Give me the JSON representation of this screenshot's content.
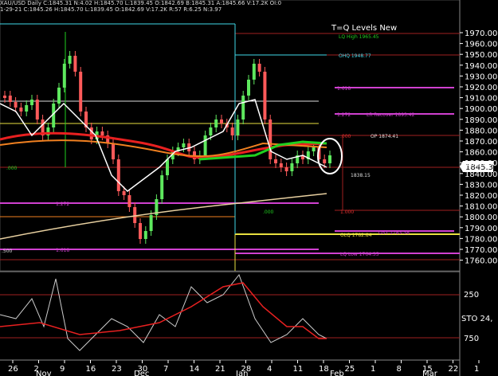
{
  "header": {
    "line1": "XAU/USD Daily  C:1845.31  N:4.02  H:1845.70  L:1839.45  O:1842.69  B:1845.31  A:1845.66  V:17.2K  OI:0",
    "line2": "1-29-21  C:1845.26  H:1845.70  L:1839.45  O:1842.69  V:17.2K  R:57  R:6.25  N:3.97",
    "title": "T=Q Levels New"
  },
  "price_axis": {
    "labels": [
      "1970.00",
      "1960.00",
      "1950.00",
      "1940.00",
      "1930.00",
      "1920.00",
      "1910.00",
      "1900.00",
      "1890.00",
      "1880.00",
      "1870.00",
      "1860.00",
      "1850.00",
      "1840.00",
      "1830.00",
      "1820.00",
      "1810.00",
      "1800.00",
      "1790.00",
      "1780.00",
      "1770.00",
      "1760.00"
    ],
    "current": "1845.31"
  },
  "date_axis": {
    "days": [
      "26",
      "2",
      "9",
      "16",
      "23",
      "30",
      "7",
      "14",
      "21",
      "28",
      "4",
      "11",
      "18",
      "25",
      "1",
      "8",
      "15",
      "22",
      "1",
      "8"
    ],
    "months": [
      "Nov",
      "Dec",
      "Jan",
      "Feb",
      "Mar"
    ]
  },
  "level_labels": {
    "lq_high": "LQ High 1965.45",
    "ohq": "OHQ 1948.77",
    "l1618_top": "1.618",
    "l1272_top": "1.272",
    "recover": "LR Recover 1893.42",
    "op": "OP 1874.41",
    "l000_top": ".000",
    "l000_mid": ".000",
    "l1838": "1838.15",
    "l1272_bot": "1.272",
    "l000_low": ".000",
    "l1000": "1.000",
    "olq": "OLQ 1782.84",
    "ost": "OST 1783.38",
    "lq_low": "LQ Low 1764.35",
    "l1618_bot": "1.618",
    "l500": ".500",
    "l1618_right": "1.618"
  },
  "oscillator": {
    "label": "STO  24,",
    "levels": [
      "250",
      "750"
    ]
  },
  "colors": {
    "up": "#5ee85e",
    "down": "#ff5a5a",
    "ma_red": "#e82020",
    "ma_orange": "#f08020",
    "ma_green": "#20d020",
    "white_line": "#ffffff",
    "magenta": "#d040d0",
    "cyan": "#40d8e8",
    "yellow": "#e8e040",
    "darkred": "#a02020"
  }
}
